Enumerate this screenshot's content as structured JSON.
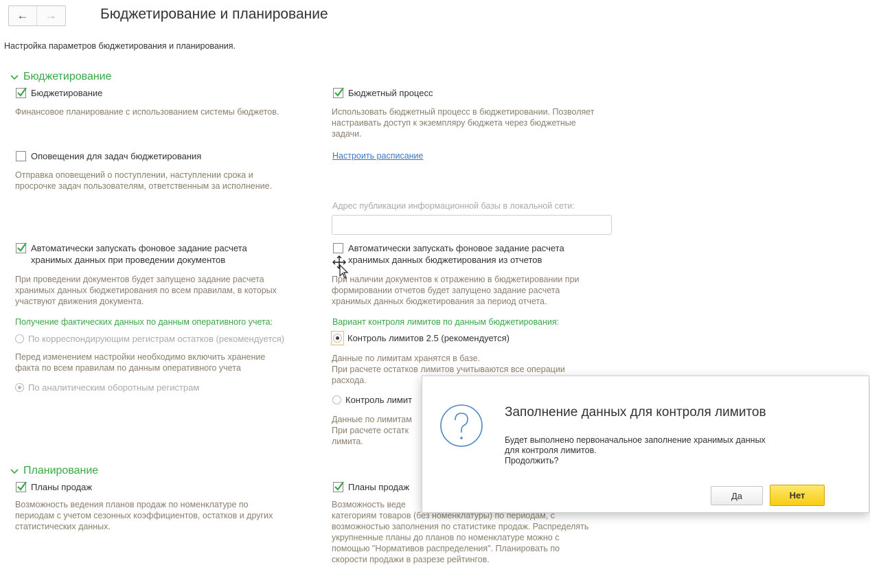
{
  "header": {
    "back_label": "←",
    "forward_label": "→",
    "title": "Бюджетирование и планирование",
    "subtitle": "Настройка параметров бюджетирования и планирования."
  },
  "budgeting": {
    "section_title": "Бюджетирование",
    "budgeting_check": {
      "label": "Бюджетирование",
      "checked": true
    },
    "budgeting_desc": "Финансовое планирование с использованием системы бюджетов.",
    "budget_process_check": {
      "label": "Бюджетный процесс",
      "checked": true
    },
    "budget_process_desc": [
      "Использовать бюджетный процесс в бюджетировании. Позволяет",
      "настраивать доступ к экземпляру бюджета через бюджетные",
      "задачи."
    ],
    "notifications_check": {
      "label": "Оповещения для задач бюджетирования",
      "checked": false
    },
    "notifications_desc": [
      "Отправка оповещений о поступлении, наступлении срока и",
      "просрочке задач пользователям, ответственным за исполнение."
    ],
    "schedule_link": "Настроить расписание",
    "publication_label": "Адрес публикации информационной базы в локальной сети:",
    "publication_value": "",
    "auto_docs_check": {
      "label": [
        "Автоматически запускать фоновое задание расчета",
        "хранимых данных при проведении документов"
      ],
      "checked": true
    },
    "auto_docs_desc": [
      "При проведении документов будет запущено задание расчета",
      "хранимых данных бюджетирования по всем правилам, в которых",
      "участвуют движения документа."
    ],
    "auto_reports_check": {
      "label": [
        "Автоматически запускать фоновое задание расчета",
        "хранимых данных бюджетирования из отчетов"
      ],
      "checked": false
    },
    "auto_reports_desc": [
      "При наличии документов к отражению в бюджетировании при",
      "формировании отчетов будет запущено задание расчета",
      "хранимых данных бюджетирования за период отчета."
    ],
    "actual_data_label": "Получение фактических данных по данным оперативного учета:",
    "radio_corr": "По корреспондирующим регистрам остатков (рекомендуется)",
    "radio_corr_desc": [
      "Перед изменением настройки необходимо включить хранение",
      "факта по всем правилам по данным оперативного учета"
    ],
    "radio_analytic": "По аналитическим оборотным регистрам",
    "limits_label": "Вариант контроля лимитов по данным бюджетирования:",
    "radio_limits25": "Контроль лимитов 2.5 (рекомендуется)",
    "limits25_desc": [
      "Данные по лимитам хранятся в базе.",
      "При расчете остатков лимитов учитываются все операции",
      "расхода."
    ],
    "radio_limits_other": "Контроль лимит",
    "limits_other_desc": [
      "Данные по лимитам",
      "При расчете остатк",
      "лимита."
    ]
  },
  "planning": {
    "section_title": "Планирование",
    "sales_plans_check": {
      "label": "Планы продаж",
      "checked": true
    },
    "sales_plans_desc": [
      "Возможность ведения планов продаж по номенклатуре по",
      "периодам с учетом сезонных коэффициентов, остатков и других",
      "статистических данных."
    ],
    "sales_plans2_check": {
      "label": "Планы продаж",
      "checked": true
    },
    "sales_plans2_desc": [
      "Возможность веде",
      "категориям товаров (без номенклатуры) по периодам, с",
      "возможностью заполнения по статистике продаж. Распределять",
      "укрупненные планы до планов по номенклатуре можно с",
      "помощью \"Нормативов распределения\". Планировать по",
      "скорости продажи в разрезе рейтингов."
    ]
  },
  "dialog": {
    "title": "Заполнение данных для контроля лимитов",
    "text": "Будет выполнено первоначальное заполнение хранимых данных\nдля контроля лимитов.\nПродолжить?",
    "yes_label": "Да",
    "no_label": "Нет",
    "icon": "question-icon"
  },
  "colors": {
    "section_green": "#37a845",
    "desc_brown": "#8c7e6c",
    "link_blue": "#3b78c3",
    "button_yellow": "#f7cd12"
  }
}
